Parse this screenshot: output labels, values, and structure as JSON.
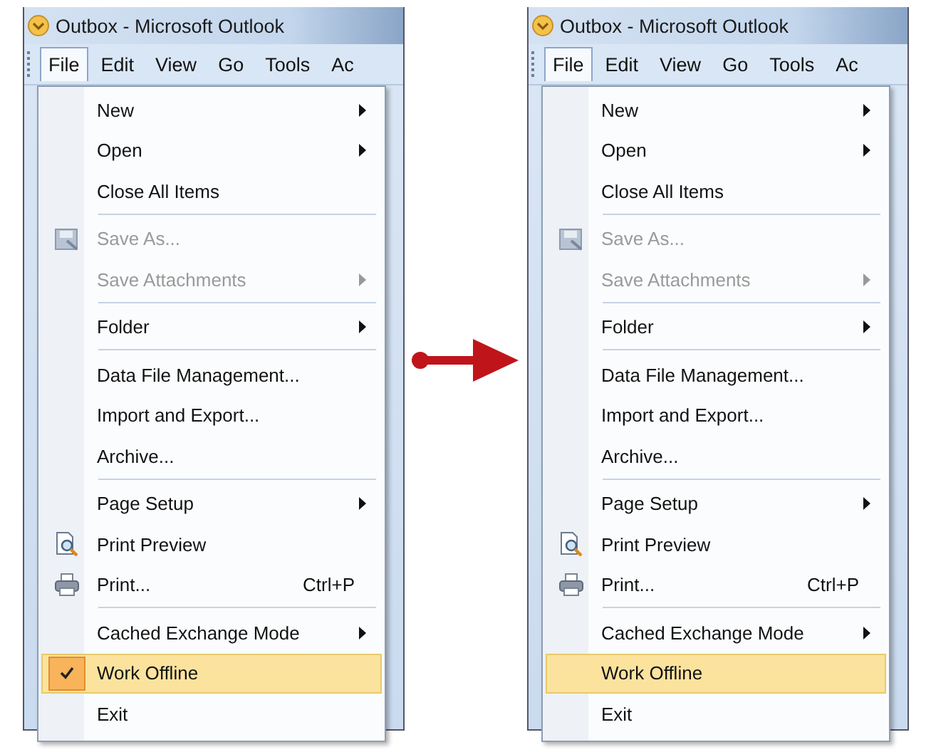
{
  "panels": [
    {
      "window": {
        "title": "Outbox - Microsoft Outlook"
      },
      "menubar": [
        {
          "label": "File",
          "selected": true
        },
        {
          "label": "Edit",
          "selected": false
        },
        {
          "label": "View",
          "selected": false
        },
        {
          "label": "Go",
          "selected": false
        },
        {
          "label": "Tools",
          "selected": false
        },
        {
          "label": "Ac",
          "selected": false
        }
      ],
      "menu": [
        {
          "kind": "plain",
          "label": "New",
          "submenu": true,
          "disabled": false,
          "checked": false,
          "selected": false
        },
        {
          "kind": "plain",
          "label": "Open",
          "submenu": true,
          "disabled": false,
          "checked": false,
          "selected": false
        },
        {
          "kind": "plain",
          "label": "Close All Items",
          "submenu": false,
          "disabled": false,
          "checked": false,
          "selected": false
        },
        {
          "kind": "separator"
        },
        {
          "kind": "save-as",
          "label": "Save As...",
          "submenu": false,
          "disabled": true,
          "checked": false,
          "selected": false
        },
        {
          "kind": "plain",
          "label": "Save Attachments",
          "submenu": true,
          "disabled": true,
          "checked": false,
          "selected": false
        },
        {
          "kind": "separator"
        },
        {
          "kind": "plain",
          "label": "Folder",
          "submenu": true,
          "disabled": false,
          "checked": false,
          "selected": false
        },
        {
          "kind": "separator"
        },
        {
          "kind": "plain",
          "label": "Data File Management...",
          "submenu": false,
          "disabled": false,
          "checked": false,
          "selected": false
        },
        {
          "kind": "plain",
          "label": "Import and Export...",
          "submenu": false,
          "disabled": false,
          "checked": false,
          "selected": false
        },
        {
          "kind": "plain",
          "label": "Archive...",
          "submenu": false,
          "disabled": false,
          "checked": false,
          "selected": false
        },
        {
          "kind": "separator"
        },
        {
          "kind": "plain",
          "label": "Page Setup",
          "submenu": true,
          "disabled": false,
          "checked": false,
          "selected": false
        },
        {
          "kind": "print-preview",
          "label": "Print Preview",
          "submenu": false,
          "disabled": false,
          "checked": false,
          "selected": false
        },
        {
          "kind": "print",
          "label": "Print...",
          "shortcut": "Ctrl+P",
          "submenu": false,
          "disabled": false,
          "checked": false,
          "selected": false
        },
        {
          "kind": "separator"
        },
        {
          "kind": "plain",
          "label": "Cached Exchange Mode",
          "submenu": true,
          "disabled": false,
          "checked": false,
          "selected": false
        },
        {
          "kind": "plain",
          "label": "Work Offline",
          "submenu": false,
          "disabled": false,
          "checked": true,
          "selected": true
        },
        {
          "kind": "plain",
          "label": "Exit",
          "submenu": false,
          "disabled": false,
          "checked": false,
          "selected": false
        }
      ]
    },
    {
      "window": {
        "title": "Outbox - Microsoft Outlook"
      },
      "menubar": [
        {
          "label": "File",
          "selected": true
        },
        {
          "label": "Edit",
          "selected": false
        },
        {
          "label": "View",
          "selected": false
        },
        {
          "label": "Go",
          "selected": false
        },
        {
          "label": "Tools",
          "selected": false
        },
        {
          "label": "Ac",
          "selected": false
        }
      ],
      "menu": [
        {
          "kind": "plain",
          "label": "New",
          "submenu": true,
          "disabled": false,
          "checked": false,
          "selected": false
        },
        {
          "kind": "plain",
          "label": "Open",
          "submenu": true,
          "disabled": false,
          "checked": false,
          "selected": false
        },
        {
          "kind": "plain",
          "label": "Close All Items",
          "submenu": false,
          "disabled": false,
          "checked": false,
          "selected": false
        },
        {
          "kind": "separator"
        },
        {
          "kind": "save-as",
          "label": "Save As...",
          "submenu": false,
          "disabled": true,
          "checked": false,
          "selected": false
        },
        {
          "kind": "plain",
          "label": "Save Attachments",
          "submenu": true,
          "disabled": true,
          "checked": false,
          "selected": false
        },
        {
          "kind": "separator"
        },
        {
          "kind": "plain",
          "label": "Folder",
          "submenu": true,
          "disabled": false,
          "checked": false,
          "selected": false
        },
        {
          "kind": "separator"
        },
        {
          "kind": "plain",
          "label": "Data File Management...",
          "submenu": false,
          "disabled": false,
          "checked": false,
          "selected": false
        },
        {
          "kind": "plain",
          "label": "Import and Export...",
          "submenu": false,
          "disabled": false,
          "checked": false,
          "selected": false
        },
        {
          "kind": "plain",
          "label": "Archive...",
          "submenu": false,
          "disabled": false,
          "checked": false,
          "selected": false
        },
        {
          "kind": "separator"
        },
        {
          "kind": "plain",
          "label": "Page Setup",
          "submenu": true,
          "disabled": false,
          "checked": false,
          "selected": false
        },
        {
          "kind": "print-preview",
          "label": "Print Preview",
          "submenu": false,
          "disabled": false,
          "checked": false,
          "selected": false
        },
        {
          "kind": "print",
          "label": "Print...",
          "shortcut": "Ctrl+P",
          "submenu": false,
          "disabled": false,
          "checked": false,
          "selected": false
        },
        {
          "kind": "separator"
        },
        {
          "kind": "plain",
          "label": "Cached Exchange Mode",
          "submenu": true,
          "disabled": false,
          "checked": false,
          "selected": false
        },
        {
          "kind": "plain",
          "label": "Work Offline",
          "submenu": false,
          "disabled": false,
          "checked": false,
          "selected": true
        },
        {
          "kind": "plain",
          "label": "Exit",
          "submenu": false,
          "disabled": false,
          "checked": false,
          "selected": false
        }
      ]
    }
  ]
}
